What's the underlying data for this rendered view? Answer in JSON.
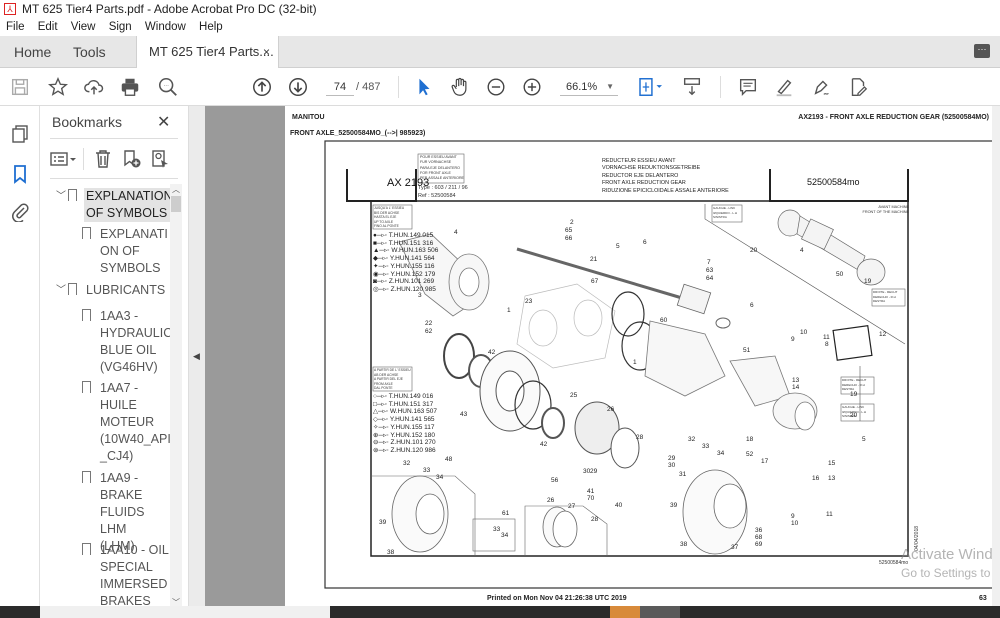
{
  "window": {
    "title": "MT 625 Tier4 Parts.pdf - Adobe Acrobat Pro DC (32-bit)"
  },
  "menu": [
    "File",
    "Edit",
    "View",
    "Sign",
    "Window",
    "Help"
  ],
  "tabs": {
    "home": "Home",
    "tools": "Tools",
    "document": "MT 625 Tier4 Parts....",
    "close": "×"
  },
  "toolbar": {
    "current_page": "74",
    "page_total": "/ 487",
    "zoom": "66.1%",
    "icons": [
      "save-icon",
      "bookmark-star-icon",
      "upload-cloud-icon",
      "print-icon",
      "search-zoom-icon",
      "page-up-icon",
      "page-down-icon",
      "select-arrow-icon",
      "hand-tool-icon",
      "zoom-out-icon",
      "zoom-in-icon",
      "page-fit-icon",
      "scroll-mode-icon",
      "comment-icon",
      "highlight-pen-icon",
      "sign-icon",
      "edit-pdf-icon"
    ]
  },
  "bookmarks": {
    "title": "Bookmarks",
    "items": [
      {
        "label": "EXPLANATION OF SYMBOLS",
        "lines": [
          "EXPLANATION",
          "OF SYMBOLS"
        ],
        "level": 0,
        "expanded": true,
        "selected": true
      },
      {
        "label": "EXPLANATION OF SYMBOLS",
        "lines": [
          "EXPLANATI",
          "ON OF",
          "SYMBOLS"
        ],
        "level": 1
      },
      {
        "label": "LUBRICANTS",
        "lines": [
          "LUBRICANTS"
        ],
        "level": 0,
        "expanded": true
      },
      {
        "label": "1AA3 - HYDRAULIC BLUE OIL (VG46HV)",
        "lines": [
          "1AA3 -",
          "HYDRAULIC",
          "BLUE OIL",
          "(VG46HV)"
        ],
        "level": 1
      },
      {
        "label": "1AA7 - HUILE MOTEUR (10W40_API_CJ4)",
        "lines": [
          "1AA7 -",
          "HUILE",
          "MOTEUR",
          "(10W40_API",
          "_CJ4)"
        ],
        "level": 1
      },
      {
        "label": "1AA9 - BRAKE FLUIDS LHM (LHM)",
        "lines": [
          "1AA9 -",
          "BRAKE",
          "FLUIDS LHM",
          "(LHM)"
        ],
        "level": 1
      },
      {
        "label": "1AA10 - OIL SPECIAL IMMERSED BRAKES",
        "lines": [
          "1AA10 - OIL",
          "SPECIAL",
          "IMMERSED",
          "BRAKES"
        ],
        "level": 1
      }
    ]
  },
  "page": {
    "header_left": "MANITOU",
    "header_right": "AX2193 - FRONT AXLE REDUCTION GEAR (52500584MO)",
    "subtitle": "FRONT AXLE_52500584MO_(-->| 985923)",
    "box_code": "AX 2193",
    "box_ref": "52500584mo",
    "applies_to": [
      "POUR ESSIEU AVANT",
      "FUR VORNACHSE",
      "PARA EJE DELANTERO",
      "FOR FRONT AXLE",
      "PER ASSALE ANTERIORE"
    ],
    "type_line": "Type : 603 / 211 / 96",
    "ref_line": "Ref : 52500584",
    "description": [
      "REDUCTEUR ESSIEU AVANT",
      "VORNACHSE REDUKTIONSGETREIBE",
      "REDUCTOR EJE DELANTERO",
      "FRONT AXLE REDUCTION GEAR",
      "RIDUZIONE EPICICLOIDALE ASSALE ANTERIORE"
    ],
    "until_axle": [
      "JUSQU'A L' ESSIEU",
      "BIS DER ACHSE",
      "HASTA EL EJE",
      "UP TO AXLE",
      "FINO AL PONTE"
    ],
    "from_axle": [
      "A PARTIR DE L' ESSIEU",
      "AB DER ACHSE",
      "A PARTIR DEL EJE",
      "FROM AXLE",
      "DAL PONTE"
    ],
    "serials_until": [
      "T.HUN.149 015",
      "T.HUN.151 316",
      "W.HUN.163 506",
      "Y.HUN.141 564",
      "Y.HUN.155 116",
      "Y.HUN.152 179",
      "Z.HUN.101 269",
      "Z.HUN.120 985"
    ],
    "serials_from": [
      "T.HUN.149 016",
      "T.HUN.151 317",
      "W.HUN.163 507",
      "Y.HUN.141 565",
      "Y.HUN.155 117",
      "Y.HUN.152 180",
      "Z.HUN.101 270",
      "Z.HUN.120 986"
    ],
    "front_label": [
      "AVANT MACHINE",
      "FRONT OF THE MACHINE"
    ],
    "left_label": [
      "GAUCHE - LINK",
      "IZQUIERDO - L.H",
      "SINISTRA"
    ],
    "right_label": [
      "DROITE - RECHT",
      "DERECHO - R.H",
      "DESTRA"
    ],
    "part_numbers": [
      "1",
      "2",
      "3",
      "4",
      "5",
      "6",
      "7",
      "9",
      "10",
      "11",
      "12",
      "13",
      "14",
      "15",
      "16",
      "17",
      "18",
      "19",
      "20",
      "21",
      "22",
      "23",
      "25",
      "26",
      "27",
      "28",
      "29",
      "30",
      "31",
      "32",
      "33",
      "34",
      "36",
      "37",
      "38",
      "39",
      "40",
      "41",
      "42",
      "43",
      "48",
      "50",
      "51",
      "52",
      "56",
      "60",
      "61",
      "62",
      "63",
      "64",
      "65",
      "66",
      "67",
      "68",
      "69",
      "70"
    ],
    "drawing_ref": "52500584mo",
    "drawing_date": "04/04/2018",
    "footer_printed": "Printed on  Mon Nov 04 21:26:38 UTC 2019",
    "page_number": "63"
  },
  "watermark": {
    "line1": "Activate Windows",
    "line2": "Go to Settings to activate Windows."
  }
}
